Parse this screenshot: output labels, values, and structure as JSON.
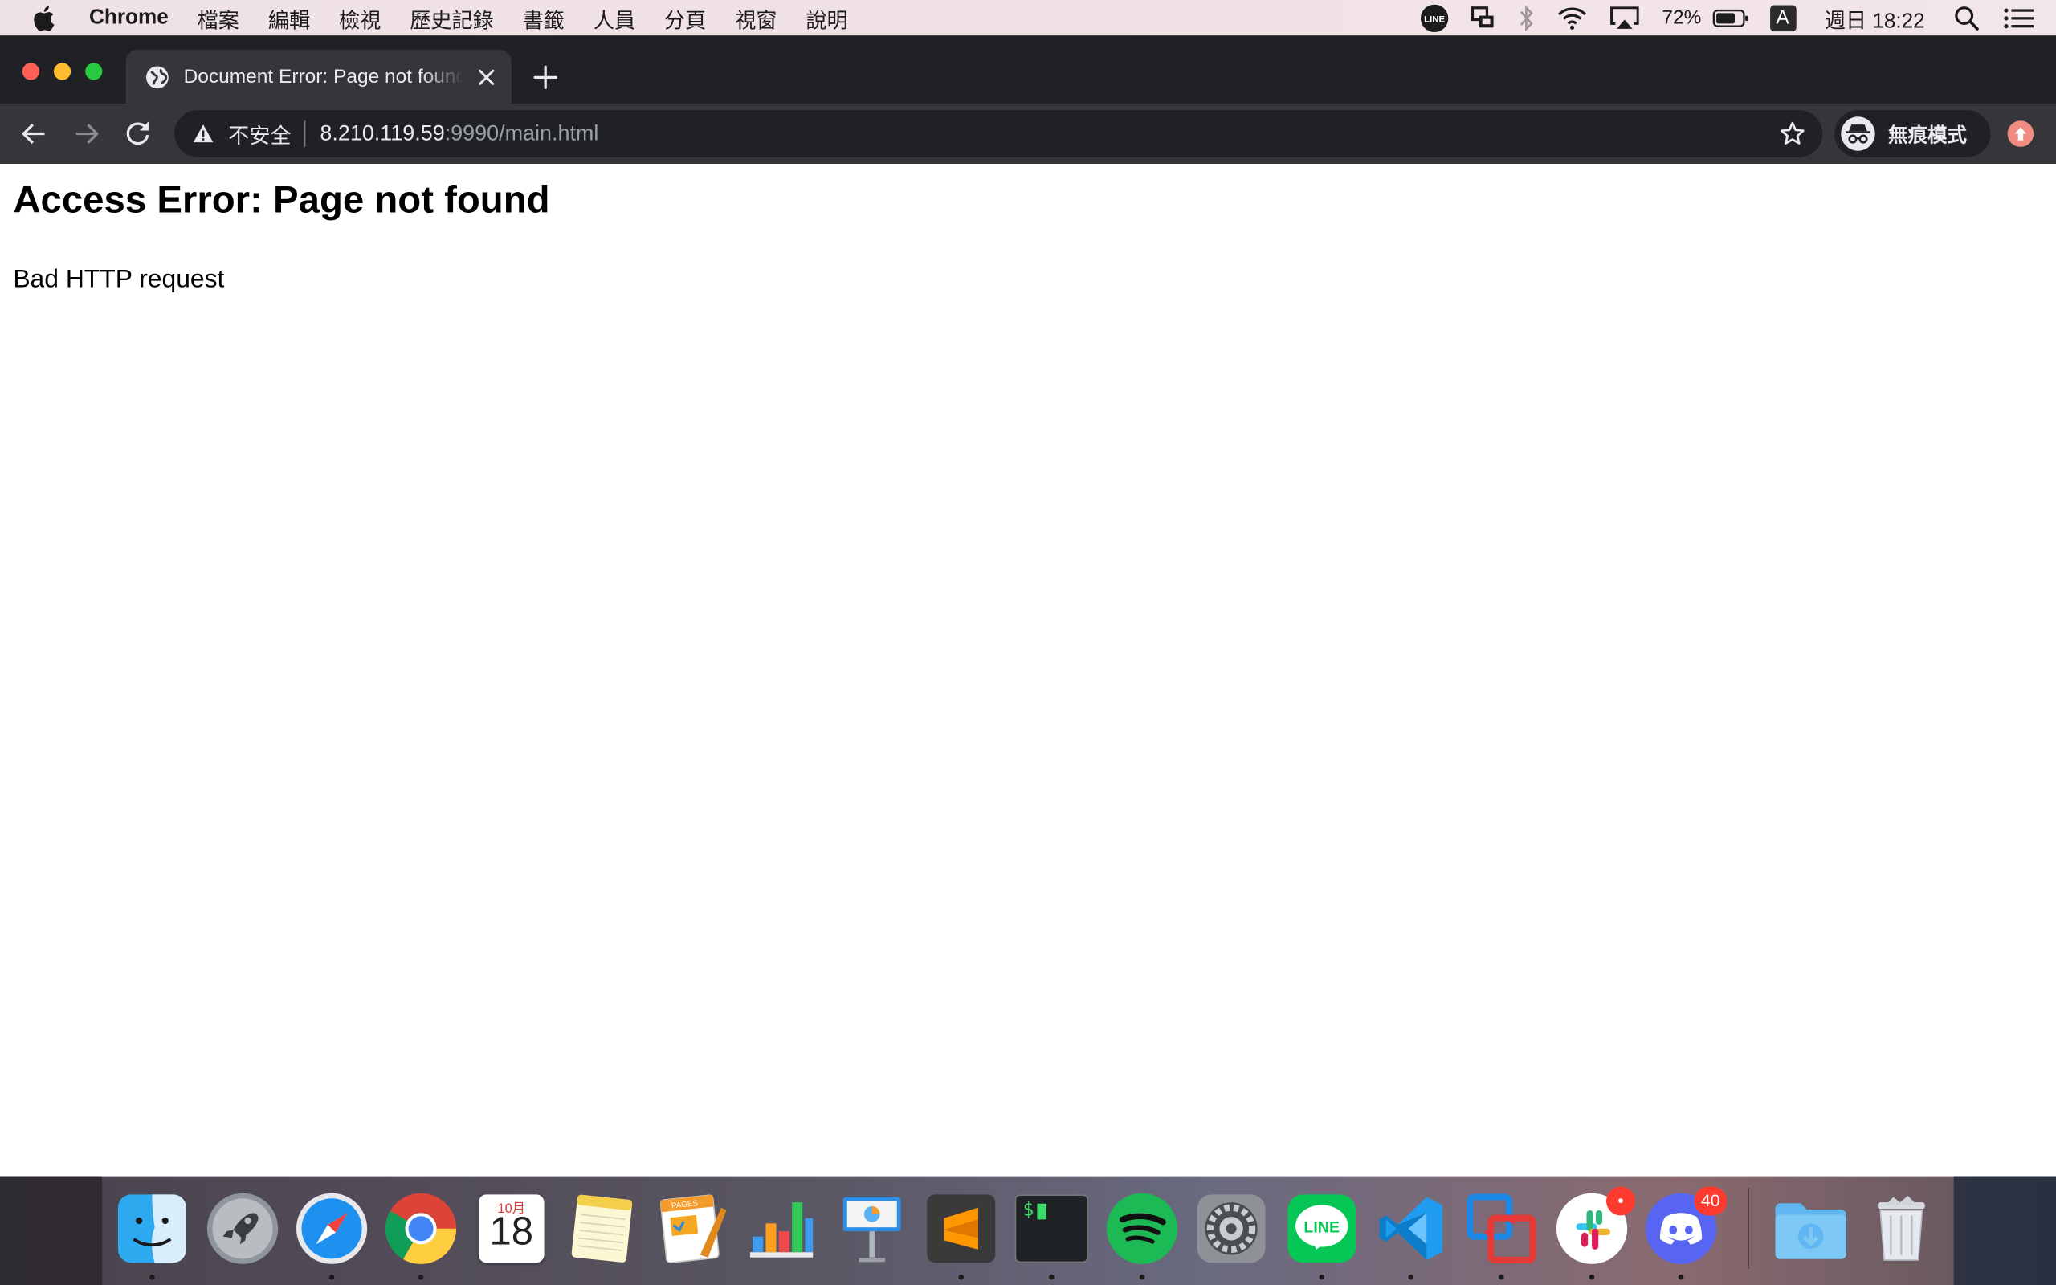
{
  "menubar": {
    "app_name": "Chrome",
    "items": [
      "檔案",
      "編輯",
      "檢視",
      "歷史記錄",
      "書籤",
      "人員",
      "分頁",
      "視窗",
      "說明"
    ],
    "status": {
      "battery": "72%",
      "input_method": "A",
      "clock": "週日 18:22"
    }
  },
  "browser": {
    "tab_title": "Document Error: Page not found",
    "security_label": "不安全",
    "url_host": "8.210.119.59",
    "url_path": ":9990/main.html",
    "profile_label": "無痕模式"
  },
  "page": {
    "heading": "Access Error: Page not found",
    "message": "Bad HTTP request"
  },
  "dock": {
    "calendar_month": "10月",
    "calendar_day": "18",
    "discord_badge": "40",
    "line_label": "LINE",
    "pages_label": "PAGES",
    "terminal_prompt": "$"
  },
  "colors": {
    "chrome_dark": "#202124",
    "toolbar": "#35363a",
    "traffic_red": "#fe5f57",
    "traffic_yellow": "#febc2e",
    "traffic_green": "#28c840"
  },
  "icons": [
    "apple-logo",
    "line-icon",
    "screen-mirroring-icon",
    "bluetooth-icon",
    "wifi-icon",
    "airplay-icon",
    "battery-icon",
    "spotlight-icon",
    "notification-center-icon",
    "globe-favicon",
    "close-icon",
    "plus-icon",
    "back-icon",
    "forward-icon",
    "reload-icon",
    "warning-icon",
    "star-icon",
    "incognito-icon",
    "update-icon"
  ]
}
